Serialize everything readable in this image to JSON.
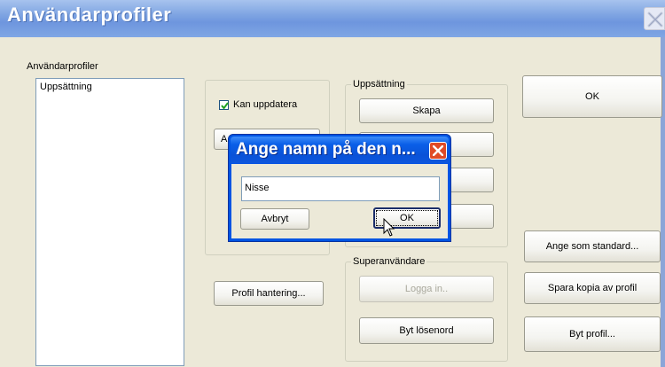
{
  "window": {
    "title": "Användarprofiler",
    "close_icon": "close-icon"
  },
  "profiles": {
    "label": "Användarprofiler",
    "items": [
      "Uppsättning"
    ],
    "selected": "Uppsättning"
  },
  "options": {
    "can_update_label": "Kan uppdatera",
    "can_update_checked": true,
    "partial_button_label": "A",
    "profile_manage_label": "Profil hantering..."
  },
  "setup_group": {
    "label": "Uppsättning",
    "create_label": "Skapa"
  },
  "superuser_group": {
    "label": "Superanvändare",
    "login_label": "Logga in..",
    "change_password_label": "Byt lösenord"
  },
  "right_buttons": {
    "ok_label": "OK",
    "set_default_label": "Ange som standard...",
    "save_copy_label": "Spara kopia av profil",
    "change_profile_label": "Byt profil..."
  },
  "dialog": {
    "title": "Ange namn på den n...",
    "input_value": "Nisse",
    "cancel_label": "Avbryt",
    "ok_label": "OK"
  }
}
